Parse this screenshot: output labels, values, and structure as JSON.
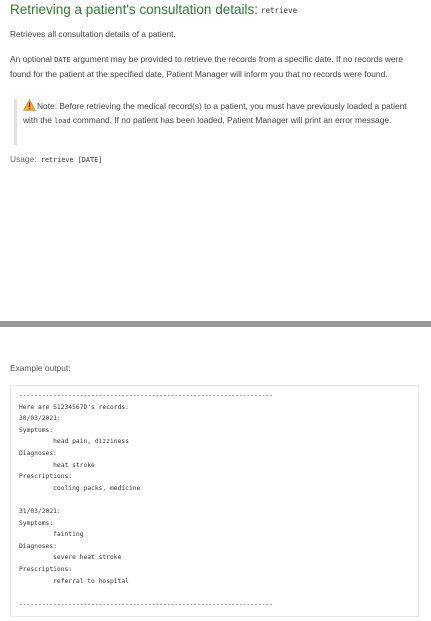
{
  "heading": {
    "title": "Retrieving a patient's consultation details:",
    "command": "retrieve"
  },
  "summary": "Retrieves all consultation details of a patient.",
  "description": {
    "part1": "An optional ",
    "arg": "DATE",
    "part2": " argument may be provided to retrieve the records from a specific date. If no records were found for the patient at the specified date, Patient Manager will inform you that no records were found."
  },
  "note": {
    "icon": "warning-icon",
    "part1": "Note: Before retrieving the medical record(s) to a patient, you must have previously loaded a patient with the ",
    "cmd": "load",
    "part2": " command. If no patient has been loaded, Patient Manager will print an error message."
  },
  "usage": {
    "label": "Usage:",
    "syntax": "retrieve [DATE]"
  },
  "example_label": "Example output:",
  "example_output": "-------------------------------------------------------------------\nHere are S1234567D's records:\n30/03/2021:\nSymptoms:\n         head pain, dizziness\nDiagnoses:\n         heat stroke\nPrescriptions:\n         cooling packs, medicine\n\n31/03/2021:\nSymptoms:\n         fainting\nDiagnoses:\n         severe heat stroke\nPrescriptions:\n         referral to hospital\n\n-------------------------------------------------------------------",
  "colors": {
    "heading": "#2e7d32",
    "warning": "#f5a623",
    "divider": "#999999"
  }
}
